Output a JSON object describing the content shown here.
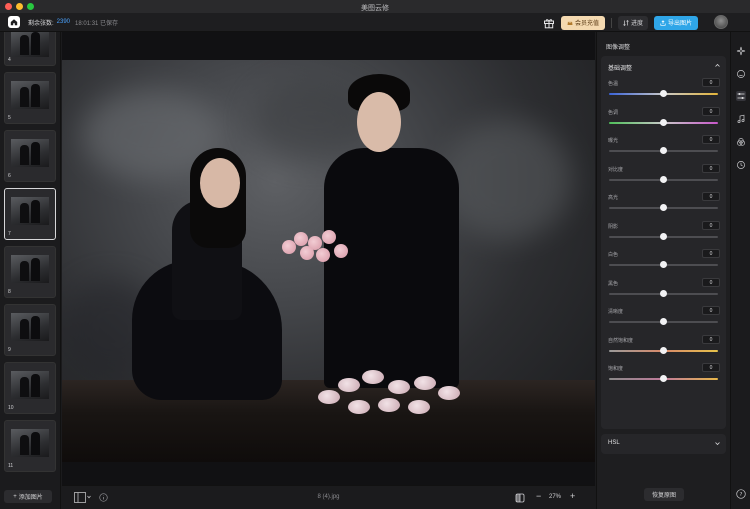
{
  "window": {
    "title": "美图云修"
  },
  "toolbar": {
    "remaining_label": "剩余张数:",
    "remaining_count": "2390",
    "saved_status": "18:01:31 已保存",
    "vip_label": "会员充值",
    "progress_label": "进度",
    "export_label": "导出图片"
  },
  "sidebar": {
    "thumbnails": [
      {
        "num": "4"
      },
      {
        "num": "5"
      },
      {
        "num": "6"
      },
      {
        "num": "7",
        "active": true
      },
      {
        "num": "8"
      },
      {
        "num": "9"
      },
      {
        "num": "10"
      },
      {
        "num": "11"
      }
    ],
    "add_label": "添加图片"
  },
  "canvas": {
    "filename": "8 (4).jpg",
    "zoom": "27%",
    "zoom_minus": "−",
    "zoom_plus": "+"
  },
  "panel": {
    "title": "图像调整",
    "section_title": "基础调整",
    "sliders": [
      {
        "label": "色温",
        "value": "0",
        "gradient": "linear-gradient(90deg,#3a63d8,#c9c9c9,#e3b43a)",
        "level": 0.5
      },
      {
        "label": "色调",
        "value": "0",
        "gradient": "linear-gradient(90deg,#4fbf5a,#c9c9c9,#c757c9)",
        "level": 0.5
      },
      {
        "label": "曝光",
        "value": "0",
        "gradient": "",
        "level": 0.5
      },
      {
        "label": "对比度",
        "value": "0",
        "gradient": "",
        "level": 0.5
      },
      {
        "label": "高光",
        "value": "0",
        "gradient": "",
        "level": 0.5
      },
      {
        "label": "阴影",
        "value": "0",
        "gradient": "",
        "level": 0.5
      },
      {
        "label": "白色",
        "value": "0",
        "gradient": "",
        "level": 0.5
      },
      {
        "label": "黑色",
        "value": "0",
        "gradient": "",
        "level": 0.5
      },
      {
        "label": "清晰度",
        "value": "0",
        "gradient": "",
        "level": 0.5
      },
      {
        "label": "自然饱和度",
        "value": "0",
        "gradient": "linear-gradient(90deg,#9a9a9a,#d98a6a,#e6c24a)",
        "level": 0.5
      },
      {
        "label": "饱和度",
        "value": "0",
        "gradient": "linear-gradient(90deg,#8a8a8a,#c07a9a,#e8b84a)",
        "level": 0.5
      }
    ],
    "hsl_label": "HSL",
    "restore_label": "恢复原图"
  },
  "rail": {
    "icons": [
      "sparkle-icon",
      "face-retouch-icon",
      "sliders-icon",
      "music-note-icon",
      "color-circles-icon",
      "history-icon"
    ],
    "help": "?"
  },
  "colors": {
    "accent": "#2fa6e8",
    "vip_bg": "#f4d9b0",
    "count_blue": "#4aa3ff"
  }
}
